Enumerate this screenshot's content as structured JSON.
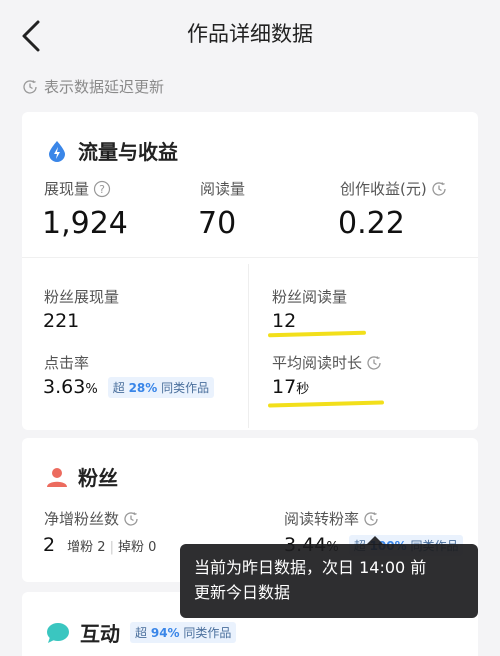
{
  "header": {
    "title": "作品详细数据"
  },
  "notice": {
    "text": "表示数据延迟更新"
  },
  "traffic": {
    "title": "流量与收益",
    "impressions": {
      "label": "展现量",
      "value": "1,924"
    },
    "reads": {
      "label": "阅读量",
      "value": "70"
    },
    "earnings": {
      "label": "创作收益(元)",
      "value": "0.22"
    },
    "fan_impressions": {
      "label": "粉丝展现量",
      "value": "221"
    },
    "fan_reads": {
      "label": "粉丝阅读量",
      "value": "12"
    },
    "ctr": {
      "label": "点击率",
      "value": "3.63",
      "unit": "%",
      "badge_prefix": "超",
      "badge_pct": "28%",
      "badge_suffix": "同类作品"
    },
    "avg_read_time": {
      "label": "平均阅读时长",
      "value": "17",
      "unit": "秒"
    }
  },
  "fans": {
    "title": "粉丝",
    "net_gain": {
      "label": "净增粉丝数",
      "value": "2",
      "gain_label": "增粉",
      "gain_value": "2",
      "loss_label": "掉粉",
      "loss_value": "0"
    },
    "conversion": {
      "label": "阅读转粉率",
      "value": "3.44",
      "unit": "%",
      "badge_prefix": "超",
      "badge_pct": "100%",
      "badge_suffix": "同类作品"
    }
  },
  "interaction": {
    "title": "互动",
    "badge_prefix": "超",
    "badge_pct": "94%",
    "badge_suffix": "同类作品"
  },
  "tooltip": {
    "line1": "当前为昨日数据，次日 14:00 前",
    "line2": "更新今日数据"
  },
  "colors": {
    "highlight": "#f2df1b",
    "accent": "#3a86e8",
    "fans_icon": "#ec6b5e",
    "chat_icon": "#3ac6c0"
  }
}
